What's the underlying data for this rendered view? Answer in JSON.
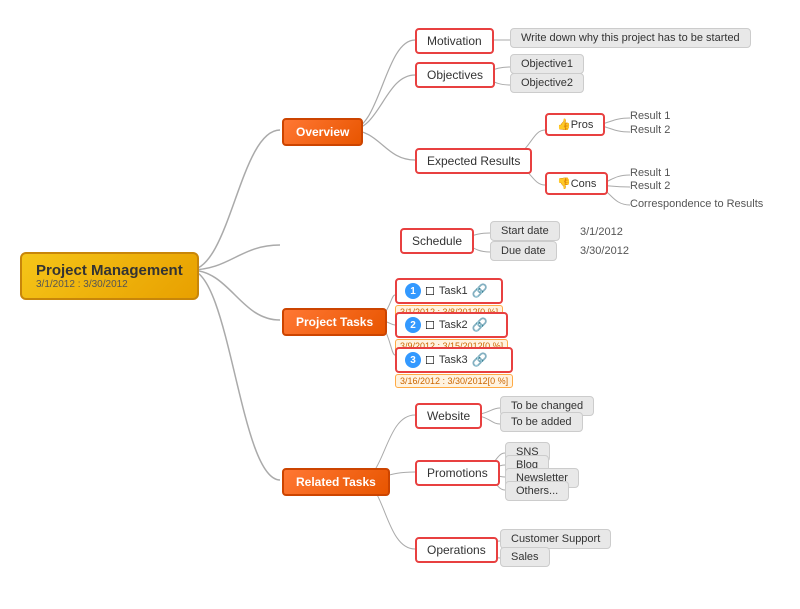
{
  "root": {
    "title": "Project Management",
    "subtitle": "3/1/2012 : 3/30/2012"
  },
  "overview": {
    "label": "Overview",
    "motivation": "Motivation",
    "motivation_text": "Write down why this project has to be started",
    "objectives": "Objectives",
    "objective1": "Objective1",
    "objective2": "Objective2",
    "expected_results": "Expected Results",
    "pros": "👍Pros",
    "pros_result1": "Result 1",
    "pros_result2": "Result 2",
    "cons": "👎Cons",
    "cons_result1": "Result 1",
    "cons_result2": "Result 2",
    "correspondence": "Correspondence to Results"
  },
  "schedule": {
    "label": "Schedule",
    "start_date_label": "Start date",
    "start_date_value": "3/1/2012",
    "due_date_label": "Due date",
    "due_date_value": "3/30/2012"
  },
  "project_tasks": {
    "label": "Project Tasks",
    "task1": {
      "num": "1",
      "name": "Task1",
      "date": "3/1/2012 : 3/8/2012[0 %]"
    },
    "task2": {
      "num": "2",
      "name": "Task2",
      "date": "3/9/2012 : 3/15/2012[0 %]"
    },
    "task3": {
      "num": "3",
      "name": "Task3",
      "date": "3/16/2012 : 3/30/2012[0 %]"
    }
  },
  "related_tasks": {
    "label": "Related Tasks",
    "website": {
      "label": "Website",
      "item1": "To be changed",
      "item2": "To be added"
    },
    "promotions": {
      "label": "Promotions",
      "item1": "SNS",
      "item2": "Blog",
      "item3": "Newsletter",
      "item4": "Others..."
    },
    "operations": {
      "label": "Operations",
      "item1": "Customer Support",
      "item2": "Sales"
    }
  }
}
